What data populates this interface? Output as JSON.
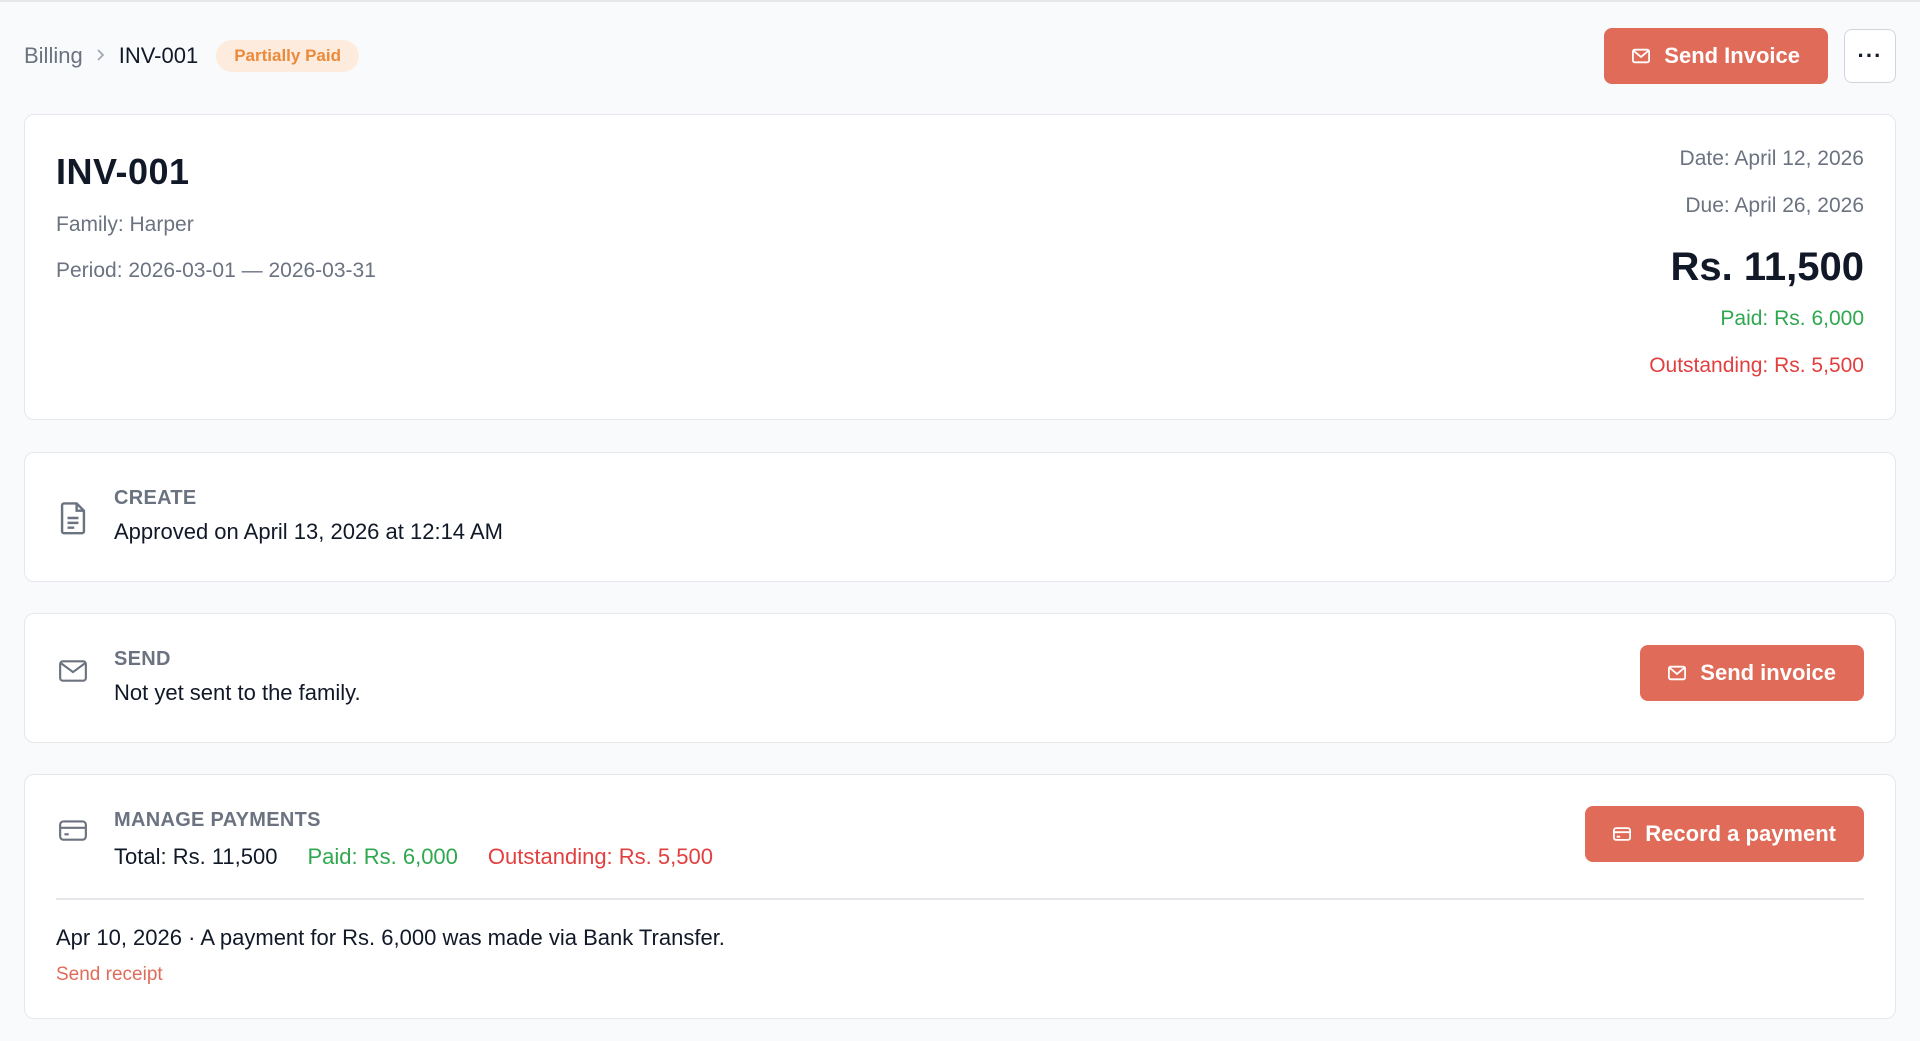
{
  "breadcrumb": {
    "parent": "Billing",
    "separator": ">",
    "current": "INV-001"
  },
  "status_badge": "Partially Paid",
  "header": {
    "send_invoice_label": "Send Invoice",
    "more_label": "···"
  },
  "invoice": {
    "number": "INV-001",
    "family": "Family: Harper",
    "period": "Period: 2026-03-01 — 2026-03-31",
    "date": "Date: April 12, 2026",
    "due": "Due: April 26, 2026",
    "total": "Rs. 11,500",
    "paid": "Paid: Rs. 6,000",
    "outstanding": "Outstanding: Rs. 5,500"
  },
  "steps": {
    "create": {
      "label": "CREATE",
      "text": "Approved on April 13, 2026 at 12:14 AM",
      "icon": "document-icon"
    },
    "send": {
      "label": "SEND",
      "text": "Not yet sent to the family.",
      "button": "Send invoice",
      "icon": "mail-icon"
    },
    "payments": {
      "label": "MANAGE PAYMENTS",
      "icon": "credit-card-icon",
      "button": "Record a payment",
      "total_label": "Total: ",
      "total_value": "Rs. 11,500",
      "paid": "Paid: Rs. 6,000",
      "outstanding": "Outstanding: Rs. 5,500",
      "entry": "Apr 10, 2026 · A payment for Rs. 6,000 was made via Bank Transfer.",
      "receipt_link": "Send receipt"
    }
  },
  "colors": {
    "accent": "#e06b58",
    "paid": "#2fa84f",
    "outstanding": "#e23f3f",
    "badge_bg": "#fdecdd",
    "badge_text": "#ea8a3a"
  }
}
